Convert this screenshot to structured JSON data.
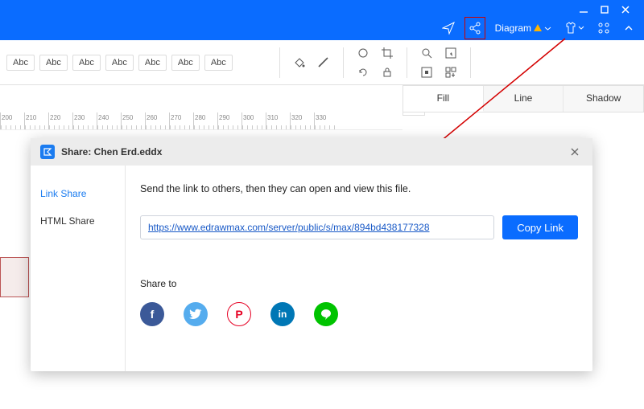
{
  "titlebar": {
    "diagram_label": "Diagram"
  },
  "ribbon": {
    "style_label": "Abc",
    "styles_count": 7
  },
  "tabs": {
    "fill": "Fill",
    "line": "Line",
    "shadow": "Shadow"
  },
  "ruler_marks": [
    "200",
    "210",
    "220",
    "230",
    "240",
    "250",
    "260",
    "270",
    "280",
    "290",
    "300",
    "310",
    "320",
    "330"
  ],
  "modal": {
    "title": "Share: Chen Erd.eddx",
    "side": {
      "link": "Link Share",
      "html": "HTML Share"
    },
    "instructions": "Send the link to others, then they can open and view this file.",
    "url": "https://www.edrawmax.com/server/public/s/max/894bd438177328",
    "copy_label": "Copy Link",
    "share_to": "Share to",
    "social": {
      "fb": "f",
      "tw": "",
      "pin": "P",
      "li": "in",
      "line": ""
    }
  }
}
